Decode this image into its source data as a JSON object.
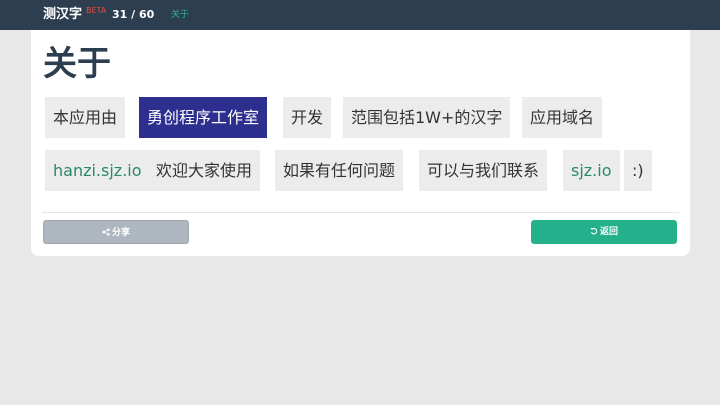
{
  "header": {
    "brand": "测汉字",
    "beta": "BETA",
    "progress": "31 / 60",
    "nav_about": "关于"
  },
  "page": {
    "title": "关于"
  },
  "words_row1": [
    "本应用由",
    "勇创程序工作室",
    "开发",
    "范围包括1W+的汉字",
    "应用域名"
  ],
  "words_row2": [
    "hanzi.sjz.io",
    "欢迎大家使用",
    "如果有任何问题",
    "可以与我们联系",
    "sjz.io",
    ":)"
  ],
  "buttons": {
    "share": "分享",
    "back": "返回"
  },
  "colors": {
    "topbar": "#2c3e50",
    "accent": "#23b08a",
    "active_word": "#2c2f8e",
    "beta": "#e74c3c"
  },
  "icons": {
    "share": "share-icon",
    "back": "undo-icon"
  }
}
